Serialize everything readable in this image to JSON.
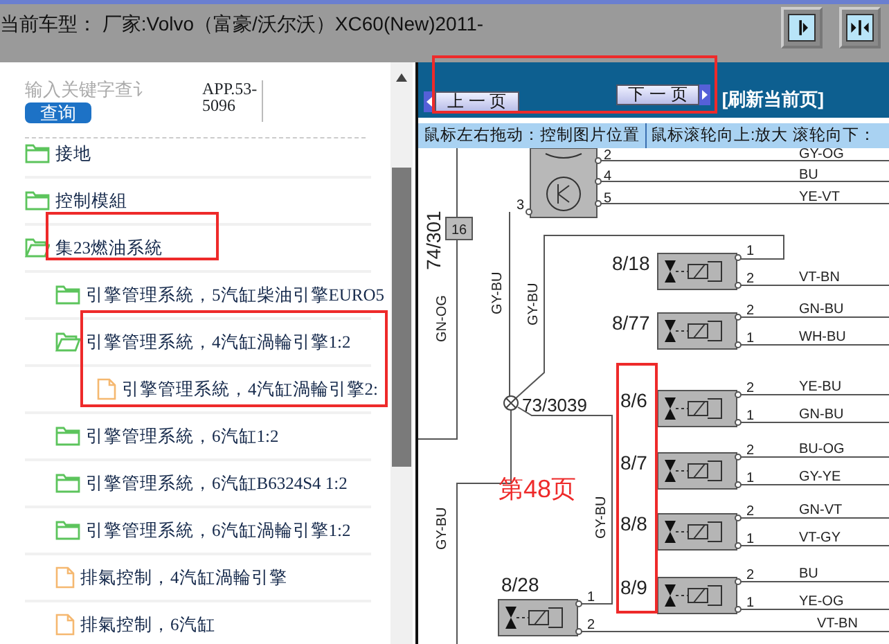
{
  "header": {
    "title": "当前车型： 厂家:Volvo（富豪/沃尔沃）XC60(New)2011-"
  },
  "search": {
    "placeholder": "输入关键字查讠",
    "button": "查询",
    "code": "APP.53-5096"
  },
  "tree": [
    {
      "label": "接地",
      "kind": "folder",
      "expanded": false
    },
    {
      "label": "控制模組",
      "kind": "folder",
      "expanded": false
    },
    {
      "label": "集23燃油系統",
      "kind": "folder",
      "expanded": true,
      "children": [
        {
          "label": "引擎管理系統，5汽缸柴油引擎EURO5",
          "kind": "folder",
          "expanded": false
        },
        {
          "label": "引擎管理系統，4汽缸渦輪引擎1:2",
          "kind": "folder",
          "expanded": true,
          "children": [
            {
              "label": "引擎管理系統，4汽缸渦輪引擎2:",
              "kind": "file"
            }
          ]
        },
        {
          "label": "引擎管理系統，6汽缸1:2",
          "kind": "folder",
          "expanded": false
        },
        {
          "label": "引擎管理系統，6汽缸B6324S4 1:2",
          "kind": "folder",
          "expanded": false
        },
        {
          "label": "引擎管理系統，6汽缸渦輪引擎1:2",
          "kind": "folder",
          "expanded": false
        },
        {
          "label": "排氣控制，4汽缸渦輪引擎",
          "kind": "file"
        },
        {
          "label": "排氣控制，6汽缸",
          "kind": "file"
        }
      ]
    }
  ],
  "viewer": {
    "prev_button": "上 一 页",
    "next_button": "下 一 页",
    "refresh_link": "[刷新当前页]",
    "hints": [
      "鼠标左右拖动：控制图片位置",
      "鼠标滚轮向上:放大  滚轮向下："
    ]
  },
  "diagram": {
    "connector": "74/301",
    "terminal": "16",
    "splice": "73/3039",
    "page_note": "第48页",
    "sensor": {
      "left_pin": "3",
      "pins": [
        {
          "number": "2",
          "wire": "GY-OG"
        },
        {
          "number": "4",
          "wire": "BU"
        },
        {
          "number": "5",
          "wire": "YE-VT"
        }
      ]
    },
    "vertical_wires": [
      "GN-OG",
      "GY-BU",
      "GY-BU",
      "GY-BU",
      "GY-BU"
    ],
    "valves": [
      {
        "label": "8/18",
        "pins": [
          {
            "number": "1"
          },
          {
            "number": "2",
            "wire": "VT-BN"
          }
        ]
      },
      {
        "label": "8/77",
        "pins": [
          {
            "number": "2",
            "wire": "GN-BU"
          },
          {
            "number": "1",
            "wire": "WH-BU"
          }
        ]
      },
      {
        "label": "8/6",
        "pins": [
          {
            "number": "2",
            "wire": "YE-BU"
          },
          {
            "number": "1",
            "wire": "GN-BU"
          }
        ]
      },
      {
        "label": "8/7",
        "pins": [
          {
            "number": "2",
            "wire": "BU-OG"
          },
          {
            "number": "1",
            "wire": "GY-YE"
          }
        ]
      },
      {
        "label": "8/8",
        "pins": [
          {
            "number": "2",
            "wire": "GN-VT"
          },
          {
            "number": "1",
            "wire": "VT-GY"
          }
        ]
      },
      {
        "label": "8/9",
        "pins": [
          {
            "number": "2",
            "wire": "BU"
          },
          {
            "number": "1",
            "wire": "YE-OG"
          }
        ]
      },
      {
        "label": "8/28",
        "pins": [
          {
            "number": "1"
          },
          {
            "number": "2",
            "wire": "VT-BN"
          }
        ]
      }
    ]
  }
}
